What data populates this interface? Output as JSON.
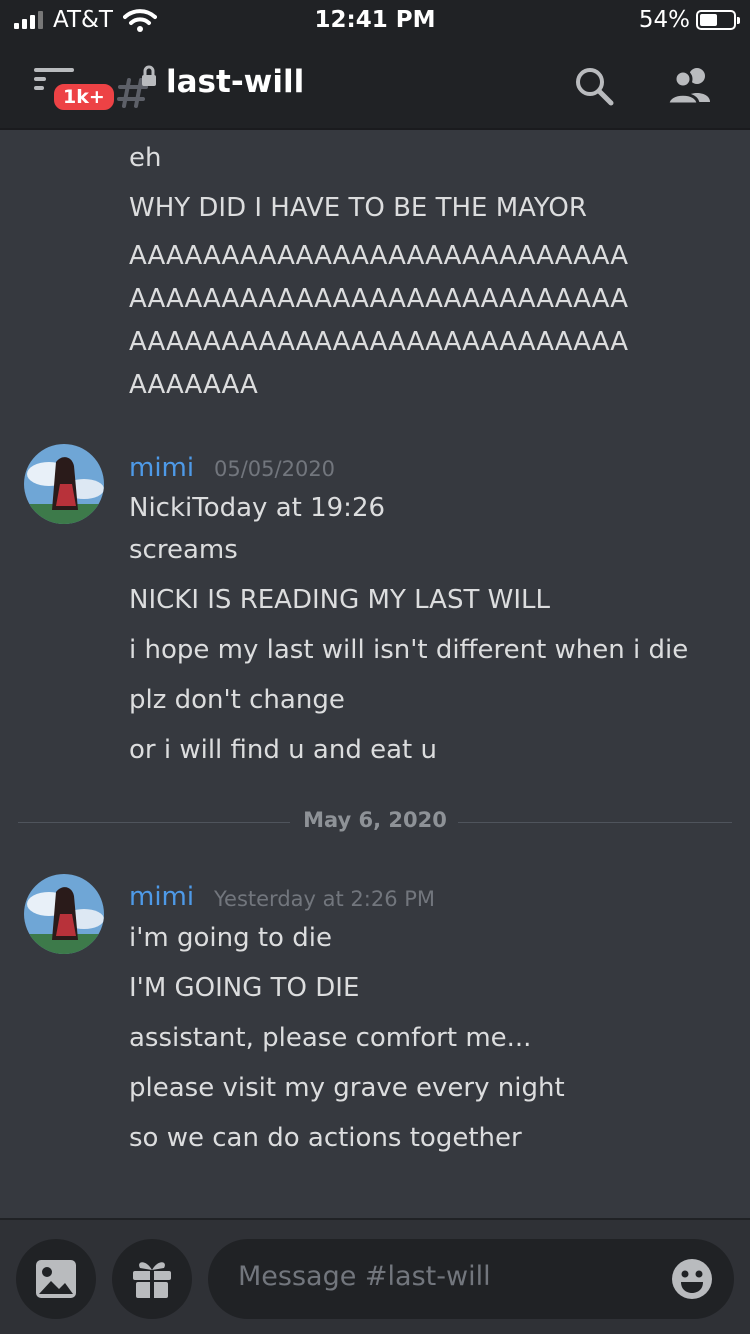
{
  "status_bar": {
    "carrier": "AT&T",
    "time": "12:41 PM",
    "battery": "54%",
    "battery_level": 0.54
  },
  "header": {
    "badge": "1k+",
    "channel_name": "last-will"
  },
  "messages": {
    "continuation_lines": [
      "eh",
      "WHY DID I HAVE TO  BE THE MAYOR",
      "AAAAAAAAAAAAAAAAAAAAAAAAAAA",
      "AAAAAAAAAAAAAAAAAAAAAAAAAAA",
      "AAAAAAAAAAAAAAAAAAAAAAAAAAA",
      "AAAAAAA"
    ],
    "groups": [
      {
        "author": "mimi",
        "timestamp": "05/05/2020",
        "lines": [
          "NickiToday at 19:26",
          "screams",
          "NICKI IS READING MY LAST WILL",
          "i hope my last will isn't different when i die",
          "plz don't change",
          "or i will find u and eat u"
        ]
      },
      {
        "author": "mimi",
        "timestamp": "Yesterday at 2:26 PM",
        "lines": [
          "i'm going to die",
          "I'M GOING TO DIE",
          "assistant, please comfort me...",
          "please visit my grave every night",
          "so we can do actions together"
        ]
      }
    ],
    "date_divider": "May 6, 2020"
  },
  "composer": {
    "placeholder": "Message #last-will"
  },
  "icons": {
    "menu": "hamburger-menu-icon",
    "channel": "locked-hash-icon",
    "search": "search-icon",
    "members": "members-icon",
    "image": "image-icon",
    "gift": "gift-icon",
    "emoji": "emoji-icon"
  },
  "colors": {
    "background": "#36393f",
    "header": "#202225",
    "author": "#4e9ae8",
    "badge": "#ed4245"
  }
}
